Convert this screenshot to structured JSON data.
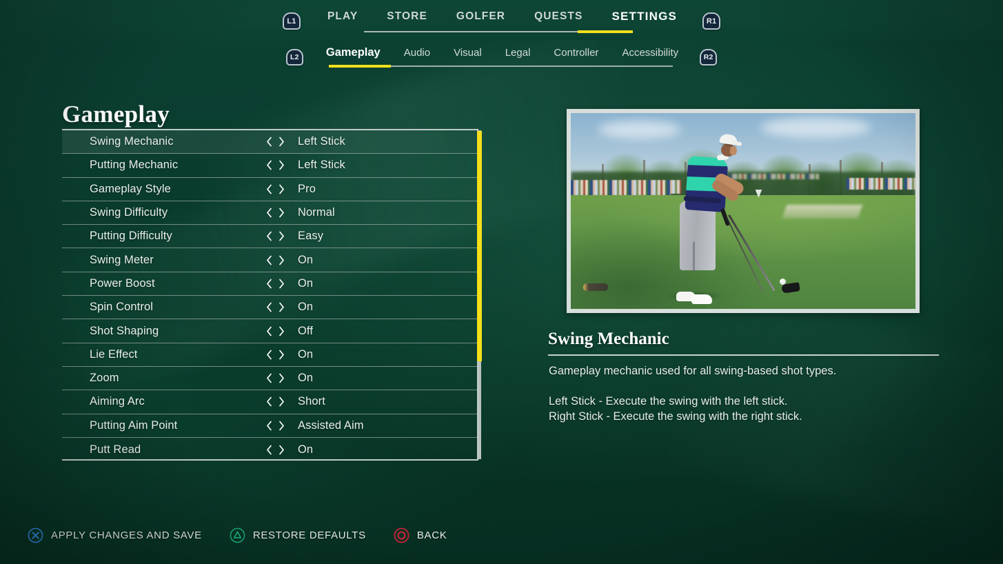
{
  "theme": {
    "bg_green": "#0a3c2e",
    "topbar_green": "#0d4434",
    "accent_yellow": "#f3df1b",
    "rule_gray": "#c3ccc8",
    "text_white": "#ffffff"
  },
  "topnav": {
    "left_bumper": "L1",
    "right_bumper": "R1",
    "tabs": [
      {
        "label": "PLAY",
        "active": false
      },
      {
        "label": "STORE",
        "active": false
      },
      {
        "label": "GOLFER",
        "active": false
      },
      {
        "label": "QUESTS",
        "active": false
      },
      {
        "label": "SETTINGS",
        "active": true
      }
    ]
  },
  "subnav": {
    "left_trigger": "L2",
    "right_trigger": "R2",
    "tabs": [
      {
        "label": "Gameplay",
        "active": true
      },
      {
        "label": "Audio",
        "active": false
      },
      {
        "label": "Visual",
        "active": false
      },
      {
        "label": "Legal",
        "active": false
      },
      {
        "label": "Controller",
        "active": false
      },
      {
        "label": "Accessibility",
        "active": false
      }
    ]
  },
  "main": {
    "page_title": "Gameplay",
    "settings": [
      {
        "label": "Swing Mechanic",
        "value": "Left Stick",
        "selected": true
      },
      {
        "label": "Putting Mechanic",
        "value": "Left Stick",
        "selected": false
      },
      {
        "label": "Gameplay Style",
        "value": "Pro",
        "selected": false
      },
      {
        "label": "Swing Difficulty",
        "value": "Normal",
        "selected": false
      },
      {
        "label": "Putting Difficulty",
        "value": "Easy",
        "selected": false
      },
      {
        "label": "Swing Meter",
        "value": "On",
        "selected": false
      },
      {
        "label": "Power Boost",
        "value": "On",
        "selected": false
      },
      {
        "label": "Spin Control",
        "value": "On",
        "selected": false
      },
      {
        "label": "Shot Shaping",
        "value": "Off",
        "selected": false
      },
      {
        "label": "Lie Effect",
        "value": "On",
        "selected": false
      },
      {
        "label": "Zoom",
        "value": "On",
        "selected": false
      },
      {
        "label": "Aiming Arc",
        "value": "Short",
        "selected": false
      },
      {
        "label": "Putting Aim Point",
        "value": "Assisted Aim",
        "selected": false
      },
      {
        "label": "Putt Read",
        "value": "On",
        "selected": false
      }
    ],
    "scroll_percent": 70
  },
  "details": {
    "title": "Swing Mechanic",
    "body": "Gameplay mechanic used for all swing-based shot types.\n\nLeft Stick - Execute the swing with the left stick.\nRight Stick - Execute the swing with the right stick."
  },
  "footer": {
    "actions": [
      {
        "icon": "playstation-cross-icon",
        "label": "APPLY CHANGES AND SAVE",
        "color": "#2f86d6"
      },
      {
        "icon": "playstation-triangle-icon",
        "label": "RESTORE DEFAULTS",
        "color": "#19a87a"
      },
      {
        "icon": "playstation-circle-icon",
        "label": "BACK",
        "color": "#d5213a"
      }
    ]
  }
}
